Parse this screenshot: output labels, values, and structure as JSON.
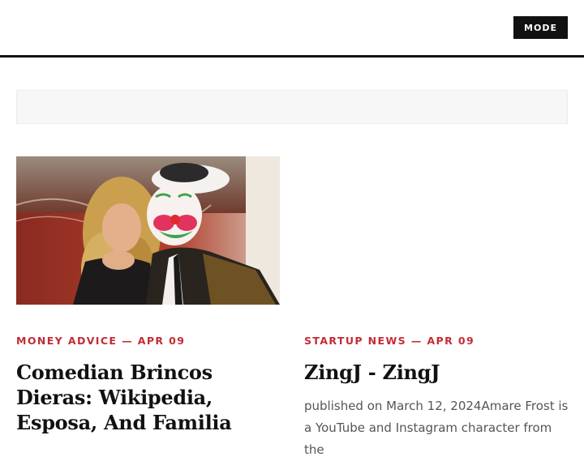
{
  "header": {
    "mode_label": "MODE"
  },
  "posts": [
    {
      "category": "MONEY ADVICE",
      "separator": " — ",
      "date": "APR 09",
      "title": "Comedian Brincos Dieras: Wikipedia, Esposa, And Familia",
      "image_alt": "Woman with blonde hair posing with a person in clown makeup and ornate gold jacket"
    },
    {
      "category": "STARTUP NEWS",
      "separator": " — ",
      "date": "APR 09",
      "title": "ZingJ - ZingJ",
      "excerpt": "published on March 12, 2024Amare Frost is a YouTube and Instagram character from the"
    }
  ],
  "colors": {
    "accent": "#c42b34",
    "text": "#111111",
    "muted": "#555555",
    "button_bg": "#111111"
  }
}
